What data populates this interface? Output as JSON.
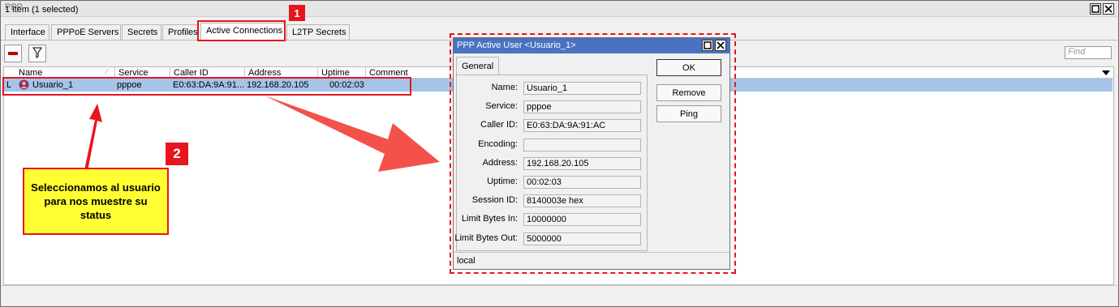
{
  "window": {
    "title": "PPP"
  },
  "tabs": [
    {
      "label": "Interface"
    },
    {
      "label": "PPPoE Servers"
    },
    {
      "label": "Secrets"
    },
    {
      "label": "Profiles"
    },
    {
      "label": "Active Connections"
    },
    {
      "label": "L2TP Secrets"
    }
  ],
  "toolbar": {
    "find_placeholder": "Find"
  },
  "table": {
    "columns": [
      "Name",
      "Service",
      "Caller ID",
      "Address",
      "Uptime",
      "Comment"
    ],
    "rows": [
      {
        "flag": "L",
        "name": "Usuario_1",
        "service": "pppoe",
        "caller_id": "E0:63:DA:9A:91...",
        "address": "192.168.20.105",
        "uptime": "00:02:03",
        "comment": ""
      }
    ]
  },
  "status": "1 item (1 selected)",
  "annotations": {
    "badge1": "1",
    "badge2": "2",
    "note": "Seleccionamos al usuario para nos muestre su status"
  },
  "dialog": {
    "title": "PPP Active User <Usuario_1>",
    "tab": "General",
    "fields": [
      {
        "label": "Name:",
        "value": "Usuario_1"
      },
      {
        "label": "Service:",
        "value": "pppoe"
      },
      {
        "label": "Caller ID:",
        "value": "E0:63:DA:9A:91:AC"
      },
      {
        "label": "Encoding:",
        "value": ""
      },
      {
        "label": "Address:",
        "value": "192.168.20.105"
      },
      {
        "label": "Uptime:",
        "value": "00:02:03"
      },
      {
        "label": "Session ID:",
        "value": "8140003e hex"
      },
      {
        "label": "Limit Bytes In:",
        "value": "10000000"
      },
      {
        "label": "Limit Bytes Out:",
        "value": "5000000"
      }
    ],
    "buttons": {
      "ok": "OK",
      "remove": "Remove",
      "ping": "Ping"
    },
    "status": "local"
  },
  "colors": {
    "accent_red": "#e8141e",
    "note_yellow": "#ffff33",
    "selection": "#a5c4e8",
    "dialog_title": "#4a72c0"
  },
  "icons": [
    "minus-icon",
    "filter-icon",
    "maximize-icon",
    "close-icon",
    "user-icon",
    "dropdown-arrow-icon",
    "sort-icon"
  ]
}
